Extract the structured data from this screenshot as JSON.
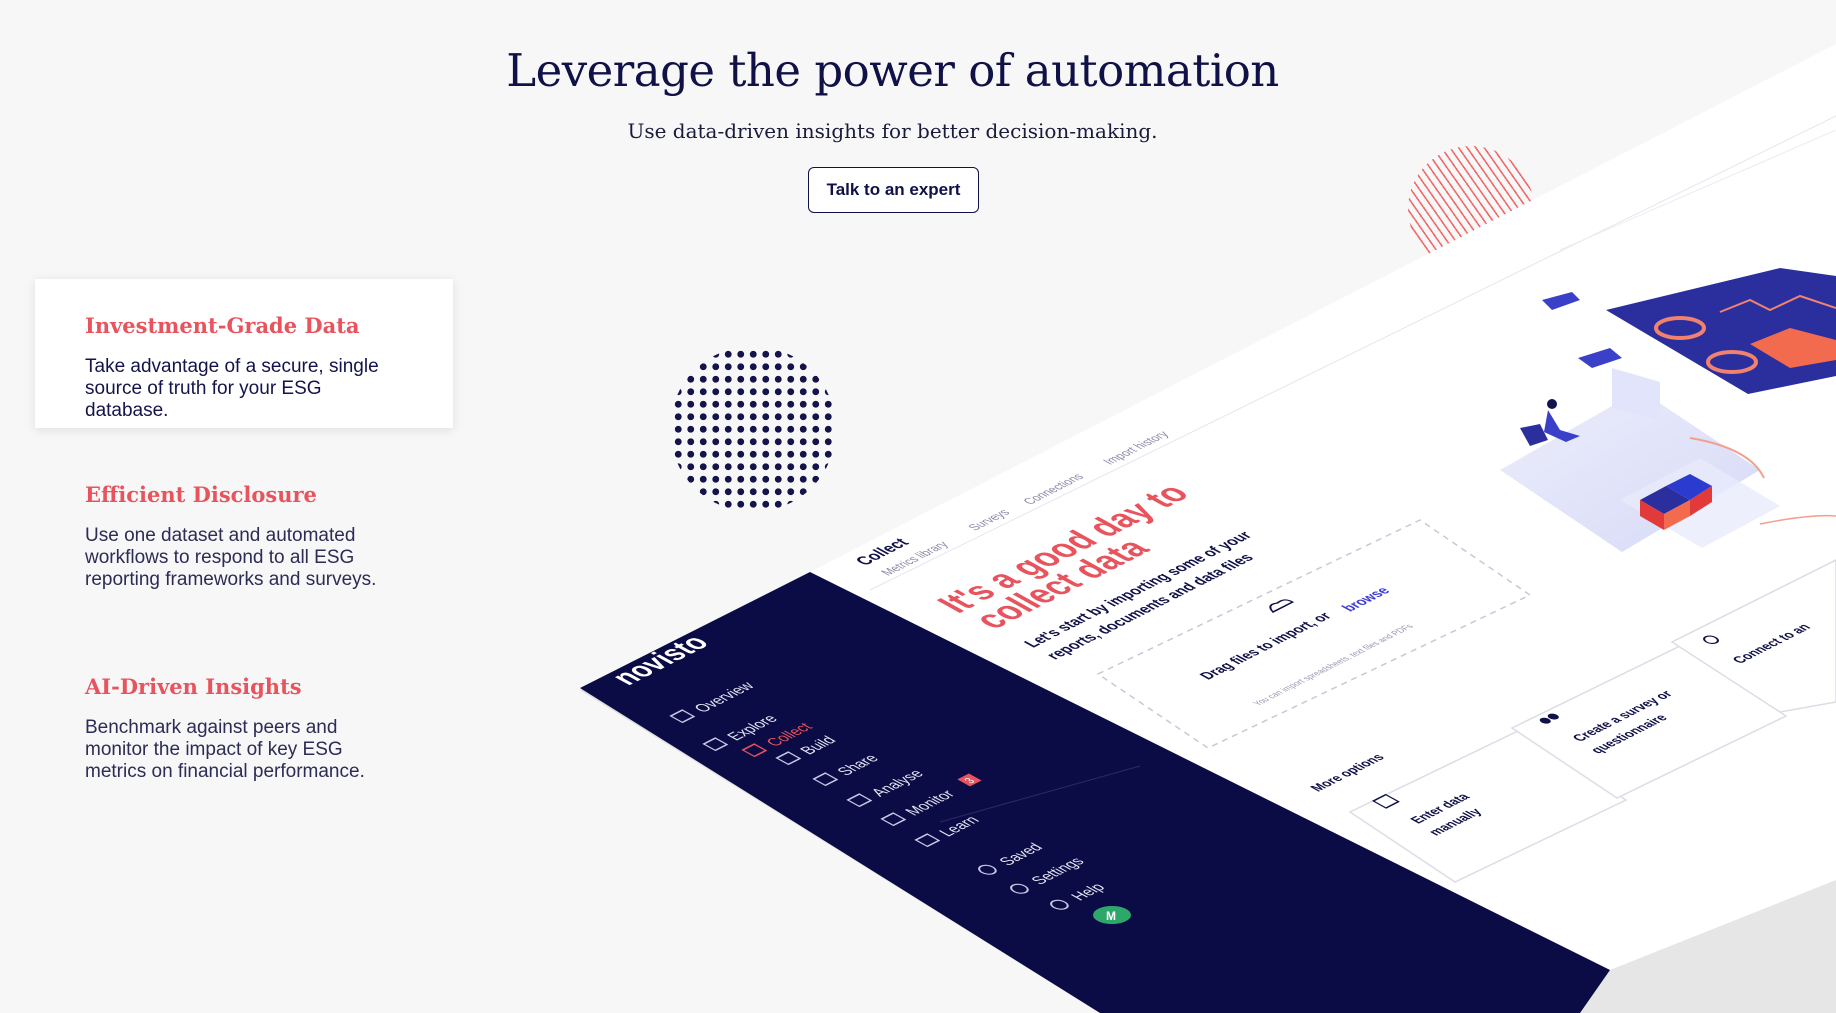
{
  "hero": {
    "title": "Leverage the power of automation",
    "subtitle": "Use data-driven insights for better decision-making.",
    "cta": "Talk to an expert"
  },
  "features": [
    {
      "title": "Investment-Grade Data",
      "body": "Take advantage of a secure, single source of truth for your ESG database."
    },
    {
      "title": "Efficient Disclosure",
      "body": "Use one dataset and automated workflows to respond to all ESG reporting frameworks and surveys."
    },
    {
      "title": "AI-Driven Insights",
      "body": "Benchmark against peers and monitor the impact of key ESG metrics on financial performance."
    }
  ],
  "app": {
    "logo": "novisto",
    "nav": [
      "Overview",
      "Explore",
      "Collect",
      "Build",
      "Share",
      "Analyse",
      "Monitor",
      "Learn"
    ],
    "nav_active": "Collect",
    "monitor_badge": "3",
    "nav_bottom": [
      "Saved",
      "Settings",
      "Help"
    ],
    "avatar": "M",
    "tabs": [
      "Collect",
      "Metrics library",
      "Surveys",
      "Connections",
      "Import history"
    ],
    "headline_line1": "It's a good day to",
    "headline_line2": "collect data",
    "intro_line1": "Let's start by importing some of your",
    "intro_line2": "reports, documents and data files",
    "drop_text": "Drag files to import, or",
    "drop_link": "browse",
    "drop_hint": "You can import spreadsheets, text files and PDFs",
    "more_options": "More options",
    "option_enter_1": "Enter data",
    "option_enter_2": "manually",
    "option_survey_1": "Create a survey or",
    "option_survey_2": "questionnaire",
    "option_connect": "Connect to an"
  },
  "colors": {
    "navy": "#0f1147",
    "coral": "#e8545d",
    "sidebar": "#0b0b45",
    "accent_blue": "#3b3bd6",
    "avatar_green": "#2ea86a"
  }
}
